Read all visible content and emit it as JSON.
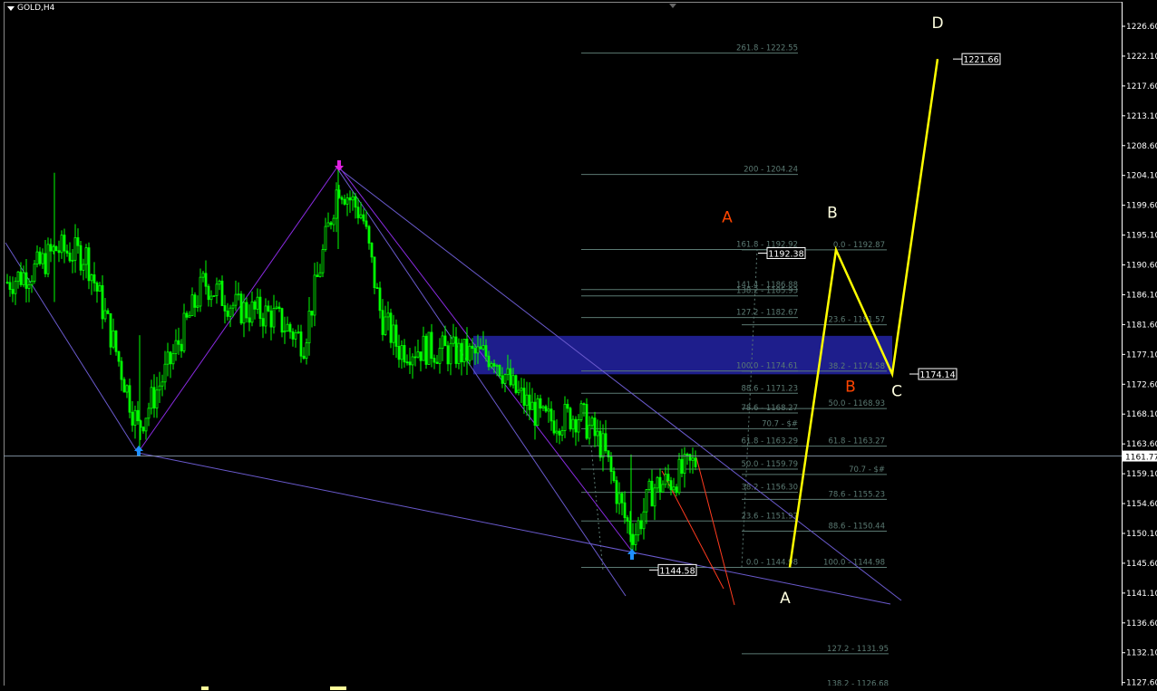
{
  "window": {
    "symbol_title": "GOLD,H4",
    "current_price": "1161.77"
  },
  "colors": {
    "background": "#000000",
    "candles": "#00ff00",
    "axis": "#ffffff",
    "fib_gray": "#5b7a73",
    "channel": "#6a5acd",
    "zigzag": "#8a2be2",
    "zone": "#1e1e8c",
    "pattern": "#ffff00",
    "red_label": "#ff4500"
  },
  "chart_data": {
    "type": "candlestick",
    "symbol": "GOLD",
    "timeframe": "H4",
    "ylim": [
      1125.2,
      1229.7
    ],
    "y_ticks": [
      "1226.60",
      "1222.10",
      "1217.60",
      "1213.10",
      "1208.60",
      "1204.10",
      "1199.60",
      "1195.10",
      "1190.60",
      "1186.10",
      "1181.60",
      "1177.10",
      "1172.60",
      "1168.10",
      "1163.60",
      "1159.10",
      "1154.60",
      "1150.10",
      "1145.60",
      "1141.10",
      "1136.60",
      "1132.10",
      "1127.60"
    ],
    "key_points": {
      "low1": 1162.5,
      "high": 1205.5,
      "low2": 1147.6
    },
    "fib_extension_A": [
      {
        "label": "261.8 - 1222.55",
        "price": 1222.55
      },
      {
        "label": "200 - 1204.24",
        "price": 1204.24
      },
      {
        "label": "161.8 - 1192.92",
        "price": 1192.92
      },
      {
        "label": "141.4 - 1186.88",
        "price": 1186.88
      },
      {
        "label": "138.2 - 1185.93",
        "price": 1185.93
      },
      {
        "label": "127.2 - 1182.67",
        "price": 1182.67
      },
      {
        "label": "100.0 - 1174.61",
        "price": 1174.61
      },
      {
        "label": "88.6 - 1171.23",
        "price": 1171.23
      },
      {
        "label": "78.6 - 1168.27",
        "price": 1168.27
      },
      {
        "label": "70.7 - $#",
        "price": 1165.9
      },
      {
        "label": "61.8 - 1163.29",
        "price": 1163.29
      },
      {
        "label": "50.0 - 1159.79",
        "price": 1159.79
      },
      {
        "label": "38.2 - 1156.30",
        "price": 1156.3
      },
      {
        "label": "23.6 - 1151.97",
        "price": 1151.97
      },
      {
        "label": "0.0 - 1144.98",
        "price": 1144.98
      },
      {
        "label": "127.2 - 1131.95",
        "price": 1131.95
      },
      {
        "label": "138.2 - 1126.68",
        "price": 1126.68
      }
    ],
    "fib_retracement_B": [
      {
        "label": "0.0 - 1192.87",
        "price": 1192.87
      },
      {
        "label": "23.6 - 1181.57",
        "price": 1181.57
      },
      {
        "label": "38.2 - 1174.58",
        "price": 1174.58
      },
      {
        "label": "50.0 - 1168.93",
        "price": 1168.93
      },
      {
        "label": "61.8 - 1163.27",
        "price": 1163.27
      },
      {
        "label": "70.7 - $#",
        "price": 1159.0
      },
      {
        "label": "78.6 - 1155.23",
        "price": 1155.23
      },
      {
        "label": "88.6 - 1150.44",
        "price": 1150.44
      },
      {
        "label": "100.0 - 1144.98",
        "price": 1144.98
      }
    ],
    "price_boxes": [
      {
        "text": "1221.66",
        "price": 1221.66
      },
      {
        "text": "1192.38",
        "price": 1192.38
      },
      {
        "text": "1174.14",
        "price": 1174.14
      },
      {
        "text": "1144.58",
        "price": 1144.58
      }
    ],
    "pattern_labels": [
      {
        "text": "A",
        "color": "#ff4500",
        "price": 1197.0
      },
      {
        "text": "B",
        "color": "#ff4500",
        "price": 1171.5
      },
      {
        "text": "B",
        "color": "#ffffe0",
        "price": 1197.7
      },
      {
        "text": "C",
        "color": "#ffffe0",
        "price": 1170.8
      },
      {
        "text": "D",
        "color": "#ffffe0",
        "price": 1226.3
      },
      {
        "text": "A",
        "color": "#ffffe0",
        "price": 1139.6
      }
    ],
    "abcd_prices": [
      1144.98,
      1192.87,
      1174.14,
      1221.66
    ],
    "supply_zone": [
      1174.1,
      1179.9
    ],
    "current_price_line": 1161.77
  }
}
